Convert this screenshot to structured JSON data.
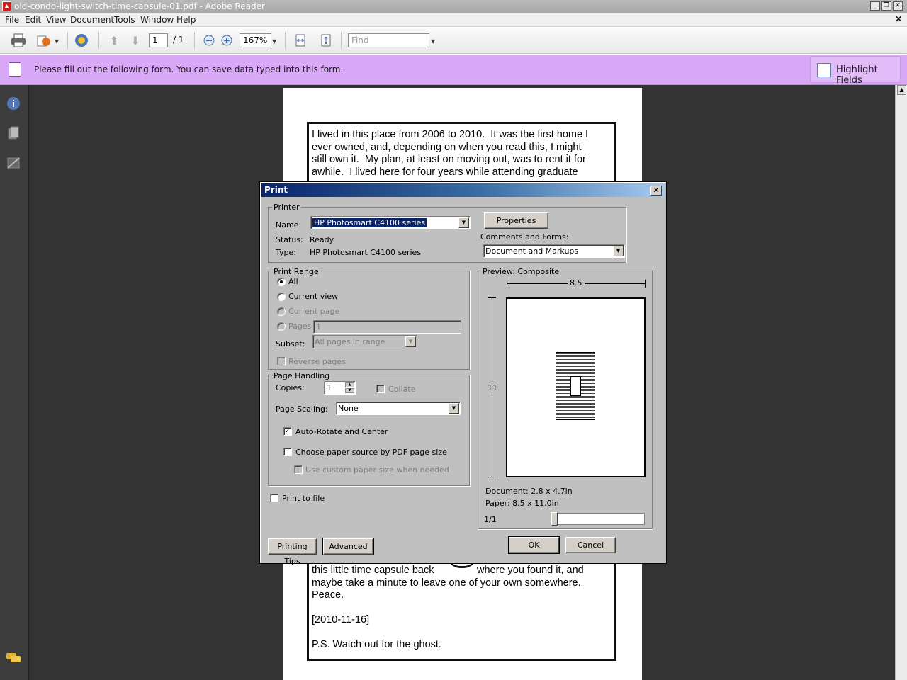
{
  "window": {
    "title": "old-condo-light-switch-time-capsule-01.pdf - Adobe Reader",
    "app_icon": "pdf-icon",
    "buttons": [
      "minimize-icon",
      "restore-icon",
      "close-icon"
    ]
  },
  "menu": {
    "items": [
      "File",
      "Edit",
      "View",
      "Document",
      "Tools",
      "Window",
      "Help"
    ],
    "close_glyph": "×"
  },
  "toolbar": {
    "page_current": "1",
    "page_total": "/ 1",
    "zoom": "167%",
    "find_placeholder": "Find"
  },
  "form_bar": {
    "message": "Please fill out the following form. You can save data typed into this form.",
    "highlight_label": "Highlight Fields",
    "color": "#d9a8f7"
  },
  "document": {
    "top_lines": [
      "I lived in this place from 2006 to 2010.  It was the first home I",
      "ever owned, and, depending on when you read this, I might",
      "still own it.  My plan, at least on moving out, was to rent it for",
      "awhile.  I lived here for four years while attending graduate"
    ],
    "bottom_left": "this little time capsule back",
    "bottom_right": "where you found it, and",
    "bottom_lines": [
      "maybe take a minute to leave one of your own somewhere.",
      "Peace."
    ],
    "date": "[2010-11-16]",
    "ps": "P.S. Watch out for the ghost."
  },
  "print_dialog": {
    "title": "Print",
    "printer": {
      "group": "Printer",
      "name_label": "Name:",
      "name_value": "HP Photosmart C4100 series",
      "status_label": "Status:",
      "status_value": "Ready",
      "type_label": "Type:",
      "type_value": "HP Photosmart C4100 series",
      "properties": "Properties",
      "comments_label": "Comments and Forms:",
      "comments_value": "Document and Markups"
    },
    "range": {
      "group": "Print Range",
      "all": "All",
      "current_view": "Current view",
      "current_page": "Current page",
      "pages": "Pages",
      "pages_value": "1",
      "subset_label": "Subset:",
      "subset_value": "All pages in range",
      "reverse": "Reverse pages"
    },
    "handling": {
      "group": "Page Handling",
      "copies_label": "Copies:",
      "copies_value": "1",
      "collate": "Collate",
      "scaling_label": "Page Scaling:",
      "scaling_value": "None",
      "auto_rotate": "Auto-Rotate and Center",
      "paper_source": "Choose paper source by PDF page size",
      "custom_size": "Use custom paper size when needed"
    },
    "print_to_file": "Print to file",
    "preview": {
      "group": "Preview: Composite",
      "width": "8.5",
      "height": "11",
      "document_size": "Document: 2.8 x 4.7in",
      "paper_size": "Paper: 8.5 x 11.0in",
      "page_counter": "1/1"
    },
    "buttons": {
      "tips": "Printing Tips",
      "advanced": "Advanced",
      "ok": "OK",
      "cancel": "Cancel"
    }
  }
}
